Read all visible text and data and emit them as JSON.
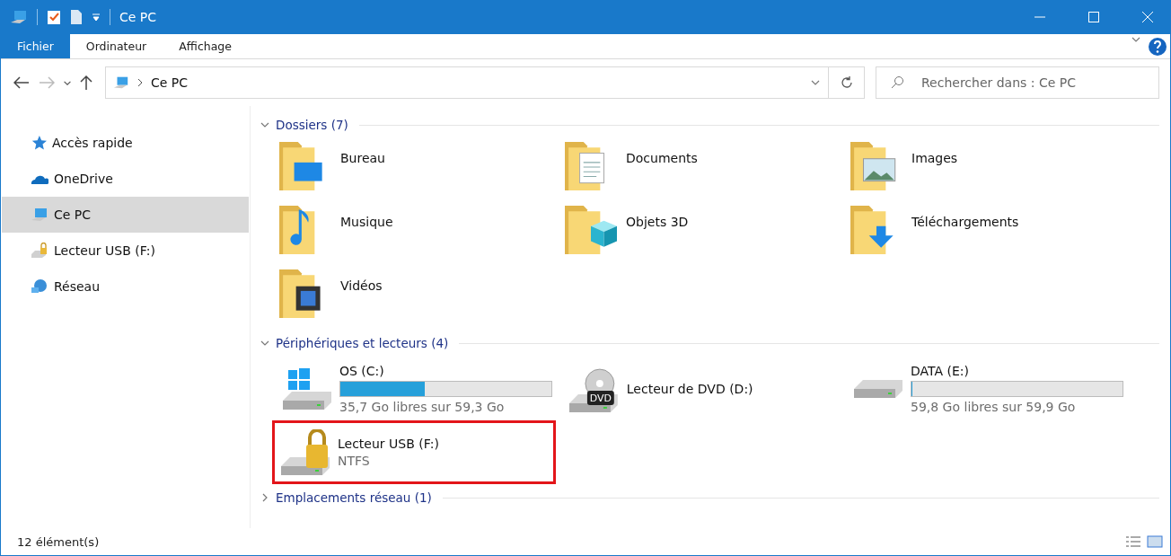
{
  "window": {
    "title": "Ce PC"
  },
  "ribbon_tabs": [
    {
      "label": "Fichier",
      "selected": true
    },
    {
      "label": "Ordinateur",
      "selected": false
    },
    {
      "label": "Affichage",
      "selected": false
    }
  ],
  "address": {
    "path": "Ce PC"
  },
  "search": {
    "placeholder": "Rechercher dans : Ce PC"
  },
  "sidebar": {
    "items": [
      {
        "label": "Accès rapide",
        "kind": "star",
        "selected": false
      },
      {
        "label": "OneDrive",
        "kind": "cloud",
        "selected": false
      },
      {
        "label": "Ce PC",
        "kind": "pc",
        "selected": true
      },
      {
        "label": "Lecteur USB (F:)",
        "kind": "usb",
        "selected": false
      },
      {
        "label": "Réseau",
        "kind": "network",
        "selected": false
      }
    ]
  },
  "sections": [
    {
      "title": "Dossiers (7)",
      "expanded": true,
      "kind": "folders",
      "items": [
        {
          "name": "Bureau",
          "kind": "desktop"
        },
        {
          "name": "Documents",
          "kind": "documents"
        },
        {
          "name": "Images",
          "kind": "pictures"
        },
        {
          "name": "Musique",
          "kind": "music"
        },
        {
          "name": "Objets 3D",
          "kind": "objects"
        },
        {
          "name": "Téléchargements",
          "kind": "downloads"
        },
        {
          "name": "Vidéos",
          "kind": "videos"
        }
      ]
    },
    {
      "title": "Périphériques et lecteurs (4)",
      "expanded": true,
      "kind": "drives",
      "items": [
        {
          "name": "OS (C:)",
          "kind": "system",
          "level": 0.4,
          "detail": "35,7 Go libres sur 59,3 Go",
          "highlighted": false
        },
        {
          "name": "Lecteur de DVD (D:)",
          "kind": "dvd",
          "icon_label": "DVD",
          "highlighted": false
        },
        {
          "name": "DATA (E:)",
          "kind": "disk",
          "level": 0.002,
          "detail": "59,8 Go libres sur 59,9 Go",
          "highlighted": false
        },
        {
          "name": "Lecteur USB (F:)",
          "kind": "locked",
          "detail": "NTFS",
          "highlighted": true
        }
      ]
    },
    {
      "title": "Emplacements réseau (1)",
      "expanded": false
    }
  ],
  "status_bar": {
    "count": "12 élément(s)"
  }
}
